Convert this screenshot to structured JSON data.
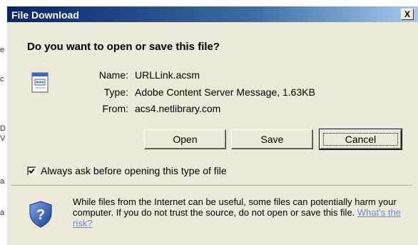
{
  "dialog": {
    "title": "File Download",
    "close_label": "X",
    "question": "Do you want to open or save this file?",
    "file": {
      "name_label": "Name:",
      "name_value": "URLLink.acsm",
      "type_label": "Type:",
      "type_value": "Adobe Content Server Message, 1.63KB",
      "from_label": "From:",
      "from_value": "acs4.netlibrary.com"
    },
    "buttons": {
      "open": "Open",
      "save": "Save",
      "cancel": "Cancel"
    },
    "checkbox": {
      "label": "Always ask before opening this type of file",
      "checked": true
    },
    "warning": {
      "text": "While files from the Internet can be useful, some files can potentially harm your computer. If you do not trust the source, do not open or save this file.",
      "link": "What's the risk?"
    }
  },
  "background_fragments": [
    "e",
    "c",
    "D",
    "V",
    "a",
    "a"
  ],
  "colors": {
    "titlebar_start": "#0A246A",
    "titlebar_end": "#A6CAF0",
    "dialog_bg": "#ECE9D8",
    "link": "#6b8fd4"
  },
  "icons": {
    "file": "file-document-icon",
    "shield": "security-shield-question-icon",
    "check": "checkmark-icon"
  }
}
